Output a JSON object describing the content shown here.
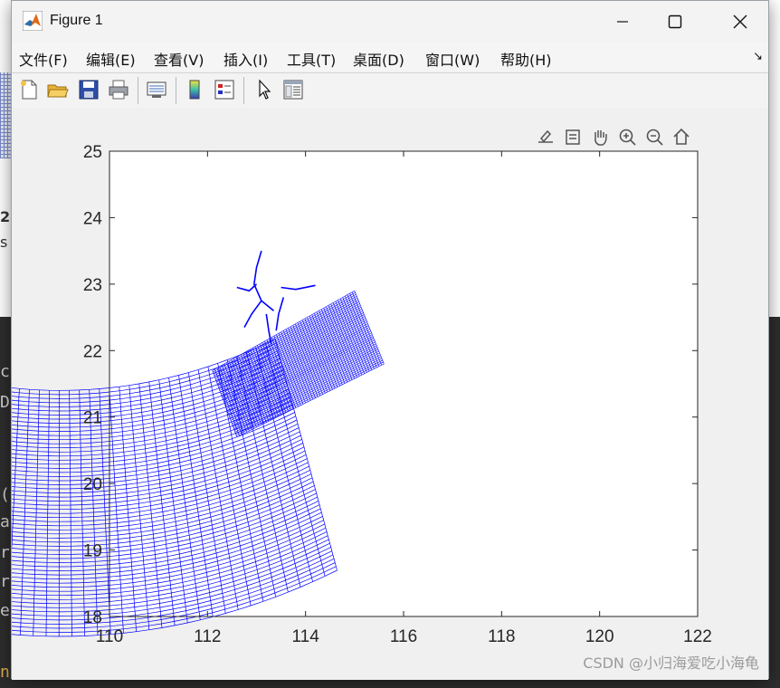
{
  "window": {
    "title": "Figure 1"
  },
  "menu": [
    "文件(F)",
    "编辑(E)",
    "查看(V)",
    "插入(I)",
    "工具(T)",
    "桌面(D)",
    "窗口(W)",
    "帮助(H)"
  ],
  "toolbar_icons": [
    "new-figure-icon",
    "open-file-icon",
    "save-icon",
    "print-icon",
    "link-plot-icon",
    "colorbar-icon",
    "legend-icon",
    "edit-plot-icon",
    "property-inspector-icon"
  ],
  "axes_toolbar_icons": [
    "export-icon",
    "brush-icon",
    "pan-icon",
    "zoom-in-icon",
    "zoom-out-icon",
    "home-icon"
  ],
  "watermark": "CSDN @小归海爱吃小海龟",
  "background_text": {
    "left_fragments": [
      "c",
      "D",
      "(",
      "a",
      "r",
      "r",
      "e",
      "n"
    ],
    "mid_fragments": [
      "2.",
      "s"
    ]
  },
  "chart_data": {
    "type": "line",
    "description_of_marks": "curvilinear ocean model grid mesh",
    "xlim": [
      110,
      122
    ],
    "ylim": [
      18,
      25
    ],
    "xticks": [
      "110",
      "112",
      "114",
      "116",
      "118",
      "120",
      "122"
    ],
    "yticks": [
      "18",
      "19",
      "20",
      "21",
      "22",
      "23",
      "24",
      "25"
    ],
    "line_color": "#0000ff",
    "grid": false,
    "mesh": {
      "origin": [
        109.0,
        34.2
      ],
      "inner_radius": 12.8,
      "outer_radius": 16.5,
      "angle_range_deg": [
        237,
        290
      ],
      "radial_lines": 58,
      "arc_lines": 60
    },
    "fine_block": {
      "corners": [
        [
          112.1,
          21.7
        ],
        [
          115.0,
          22.9
        ],
        [
          115.6,
          21.8
        ],
        [
          112.6,
          20.7
        ]
      ]
    },
    "river_channels": [
      [
        [
          113.1,
          23.5
        ],
        [
          113.0,
          23.25
        ],
        [
          112.95,
          23.0
        ],
        [
          113.1,
          22.75
        ],
        [
          113.35,
          22.6
        ]
      ],
      [
        [
          112.6,
          22.95
        ],
        [
          112.85,
          22.9
        ],
        [
          113.0,
          23.0
        ]
      ],
      [
        [
          113.5,
          22.95
        ],
        [
          113.8,
          22.92
        ],
        [
          114.2,
          22.98
        ]
      ],
      [
        [
          112.75,
          22.35
        ],
        [
          112.9,
          22.55
        ],
        [
          113.1,
          22.75
        ]
      ],
      [
        [
          113.55,
          22.8
        ],
        [
          113.45,
          22.55
        ],
        [
          113.4,
          22.3
        ]
      ],
      [
        [
          113.2,
          22.55
        ],
        [
          113.25,
          22.3
        ],
        [
          113.3,
          22.1
        ]
      ]
    ]
  }
}
